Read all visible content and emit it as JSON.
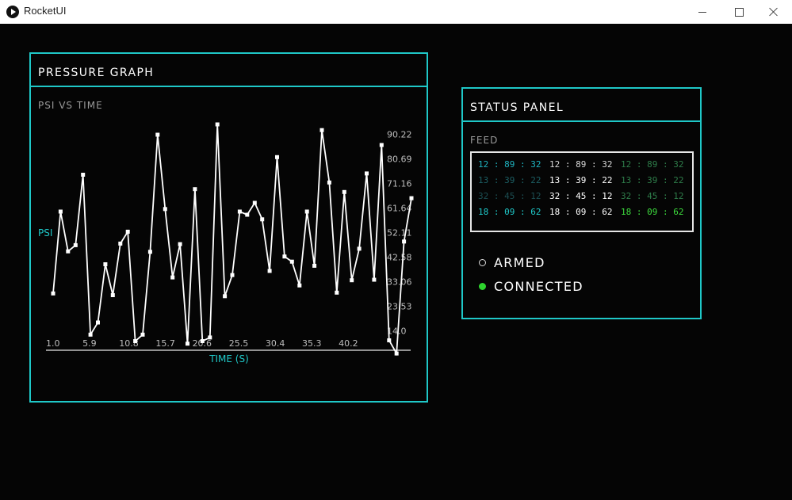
{
  "window": {
    "title": "RocketUI"
  },
  "pressure_graph": {
    "title": "PRESSURE GRAPH",
    "subtitle": "PSI VS TIME",
    "y_axis_label": "PSI",
    "x_axis_label": "TIME (S)",
    "y_ticks": [
      "90.22",
      "80.69",
      "71.16",
      "61.64",
      "52.11",
      "42.58",
      "33.06",
      "23.53",
      "14.0"
    ],
    "x_ticks": [
      "1.0",
      "5.9",
      "10.8",
      "15.7",
      "20.6",
      "25.5",
      "30.4",
      "35.3",
      "40.2"
    ],
    "colors": {
      "line": "#ffffff",
      "axis_label": "#1fc8c8",
      "border": "#1fc8c8"
    }
  },
  "chart_data": {
    "type": "line",
    "title": "",
    "subtitle": "PSI VS TIME",
    "xlabel": "TIME (S)",
    "ylabel": "PSI",
    "xlim": [
      1.0,
      49.0
    ],
    "ylim": [
      8.0,
      94.0
    ],
    "grid": false,
    "series": [
      {
        "x": [
          1.0,
          2.0,
          3.0,
          4.0,
          5.0,
          6.0,
          7.0,
          8.0,
          9.0,
          10.0,
          11.0,
          12.0,
          13.0,
          14.0,
          15.0,
          16.0,
          17.0,
          18.0,
          19.0,
          20.0,
          21.0,
          22.0,
          23.0,
          24.0,
          25.0,
          26.0,
          27.0,
          28.0,
          29.0,
          30.0,
          31.0,
          32.0,
          33.0,
          34.0,
          35.0,
          36.0,
          37.0,
          38.0,
          39.0,
          40.0,
          41.0,
          42.0,
          43.0,
          44.0,
          45.0,
          46.0,
          47.0,
          48.0,
          49.0
        ],
        "y": [
          28.5,
          60.2,
          44.8,
          47.2,
          74.5,
          12.5,
          17.2,
          39.8,
          27.8,
          47.8,
          52.4,
          10.0,
          12.5,
          44.6,
          90.0,
          61.2,
          34.7,
          47.6,
          9.0,
          68.9,
          10.0,
          11.4,
          94.0,
          27.4,
          35.6,
          60.2,
          59.0,
          63.6,
          57.2,
          37.2,
          81.3,
          42.8,
          40.8,
          31.6,
          60.2,
          39.2,
          91.8,
          71.5,
          28.8,
          67.8,
          33.6,
          45.8,
          75.0,
          33.8,
          86.0,
          10.3,
          5.2,
          48.6,
          65.4
        ]
      }
    ]
  },
  "status_panel": {
    "title": "STATUS PANEL",
    "feed_label": "FEED",
    "feed_rows": [
      [
        "12 : 89 : 32",
        "12 : 89 : 32",
        "12 : 89 : 32"
      ],
      [
        "13 : 39 : 22",
        "13 : 39 : 22",
        "13 : 39 : 22"
      ],
      [
        "32 : 45 : 12",
        "32 : 45 : 12",
        "32 : 45 : 12"
      ],
      [
        "18 : 09 : 62",
        "18 : 09 : 62",
        "18 : 09 : 62"
      ]
    ],
    "feed_colors": [
      [
        "#1fb3c0",
        "#d8d8d8",
        "#2e7d4a"
      ],
      [
        "#1c5e63",
        "#ffffff",
        "#2e7d4a"
      ],
      [
        "#1c4e52",
        "#ffffff",
        "#2e7d4a"
      ],
      [
        "#1fc8c8",
        "#ffffff",
        "#3ddc3d"
      ]
    ],
    "statuses": [
      {
        "label": "ARMED",
        "state": "off"
      },
      {
        "label": "CONNECTED",
        "state": "on",
        "color": "#2ed42e"
      }
    ]
  }
}
